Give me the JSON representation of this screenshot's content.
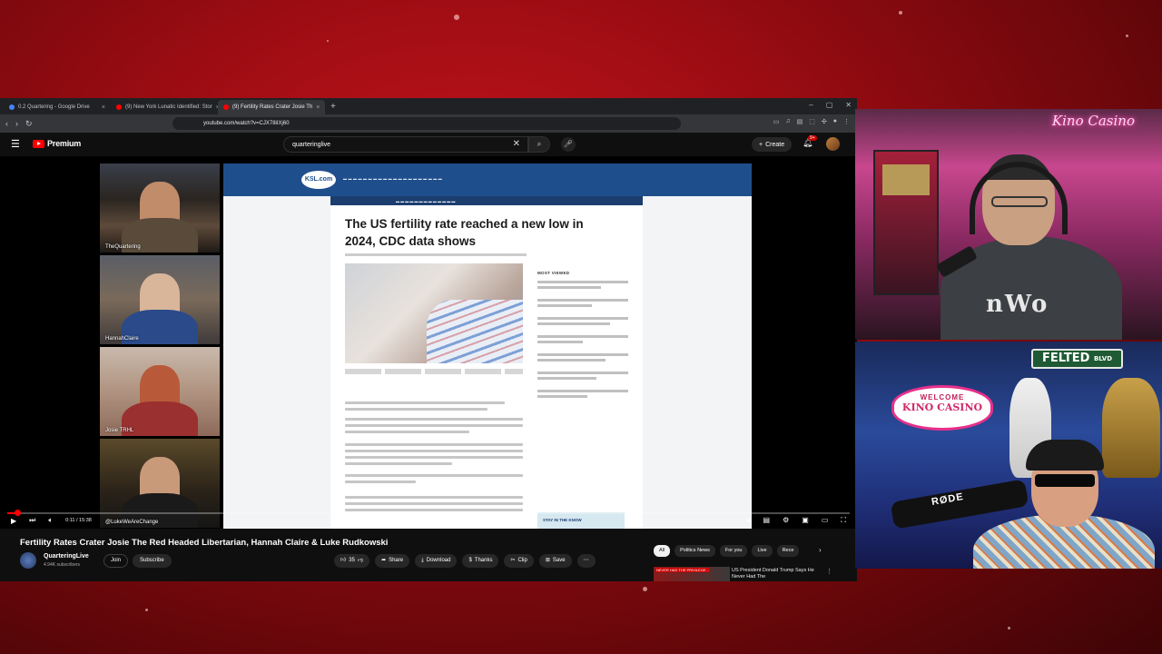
{
  "browser": {
    "tabs": [
      {
        "label": "0.2 Quartering - Google Drive",
        "active": false,
        "color": "#4285f4"
      },
      {
        "label": "(9) New York Lunatic Identified: Stor",
        "active": false,
        "color": "#ff0000"
      },
      {
        "label": "(9) Fertility Rates Crater Josie Th",
        "active": true,
        "color": "#ff0000"
      }
    ],
    "new_tab": "+",
    "url": "youtube.com/watch?v=CJX78iIXj60"
  },
  "youtube": {
    "brand": "Premium",
    "search_query": "quarteringlive",
    "create_label": "Create",
    "notif_count": "9+"
  },
  "video": {
    "cams": [
      {
        "label": "TheQuartering"
      },
      {
        "label": "HannahClaire"
      },
      {
        "label": "Josie TRHL"
      },
      {
        "label": "@LukeWeAreChange"
      }
    ],
    "article": {
      "site": "KSL.com",
      "headline": "The US fertility rate reached a new low in 2024, CDC data shows",
      "most_viewed": "MOST VIEWED",
      "stay_in_know": "STAY IN THE KNOW"
    },
    "time": "0:11 / 15:38"
  },
  "meta": {
    "title": "Fertility Rates Crater Josie The Red Headed Libertarian, Hannah Claire & Luke Rudkowski",
    "channel": "QuarteringLive",
    "subs": "4.94K subscribers",
    "join": "Join",
    "subscribe": "Subscribe",
    "likes": "35",
    "share": "Share",
    "download": "Download",
    "thanks": "Thanks",
    "clip": "Clip",
    "save": "Save"
  },
  "chips": [
    "All",
    "Politics News",
    "For you",
    "Live",
    "Rece"
  ],
  "recommendation": {
    "badge": "NEVER HAD THE PRIVILEGE...",
    "title": "US President Donald Trump Says He Never Had The"
  },
  "overlays": {
    "brand": "Kino Casino",
    "shirt": "nWo",
    "street_sign": "FELTED",
    "street_suffix": "BLVD",
    "welcome": "WELCOME",
    "casino": "KINO CASINO",
    "mic_brand": "RØDE"
  }
}
